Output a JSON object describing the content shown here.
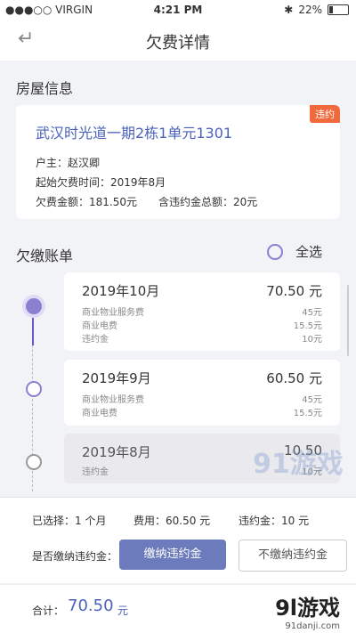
{
  "status": {
    "carrier": "●●●○○ VIRGIN",
    "time": "4:21 PM",
    "bluetooth": "✱",
    "battery": "22%"
  },
  "nav": {
    "back_icon": "↵",
    "title": "欠费详情"
  },
  "house": {
    "section_title": "房屋信息",
    "address": "武汉时光道一期2栋1单元1301",
    "badge": "违约",
    "owner": "户主：赵汉卿",
    "start_time": "起始欠费时间：2019年8月",
    "arrears": "欠费金额：181.50元",
    "penalty_total": "含违约金总额：20元"
  },
  "bills_section": {
    "title": "欠缴账单",
    "select_all": "全选"
  },
  "bills": [
    {
      "month": "2019年10月",
      "amount": "70.50 元",
      "items": [
        {
          "name": "商业物业服务费",
          "value": "45元"
        },
        {
          "name": "商业电费",
          "value": "15.5元"
        },
        {
          "name": "违约金",
          "value": "10元"
        }
      ]
    },
    {
      "month": "2019年9月",
      "amount": "60.50 元",
      "items": [
        {
          "name": "商业物业服务费",
          "value": "45元"
        },
        {
          "name": "商业电费",
          "value": "15.5元"
        }
      ]
    },
    {
      "month": "2019年8月",
      "amount": "10.50",
      "items": [
        {
          "name": "违约金",
          "value": "10元"
        }
      ]
    }
  ],
  "summary": {
    "selected": "已选择：1 个月",
    "fee": "费用：60.50 元",
    "penalty": "违约金：10 元",
    "question": "是否缴纳违约金：",
    "pay_btn": "缴纳违约金",
    "nopay_btn": "不缴纳违约金"
  },
  "footer": {
    "label": "合计：",
    "total": "70.50",
    "unit": "元"
  },
  "watermark": {
    "text": "91游戏",
    "logo": "9l游戏",
    "site": "91danji.com"
  },
  "colors": {
    "accent": "#4a62b8",
    "purple": "#8b7fd0",
    "badge": "#f06a3d",
    "button": "#6b7bbb"
  }
}
